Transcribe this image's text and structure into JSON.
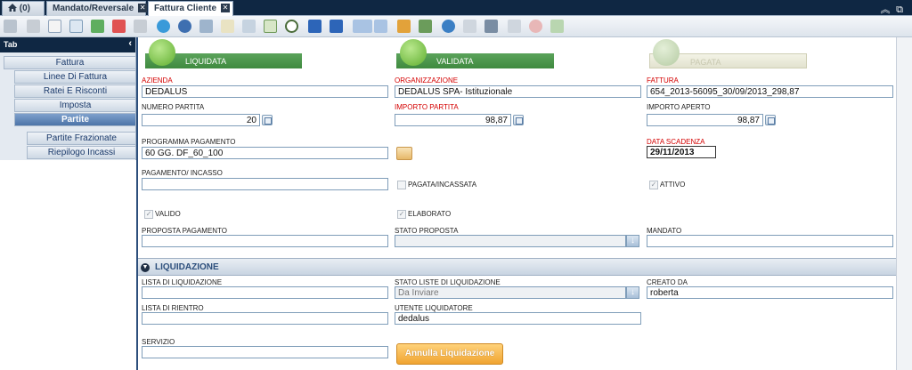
{
  "tabs": [
    {
      "label": "(0)"
    },
    {
      "label": "Mandato/Reversale"
    },
    {
      "label": "Fattura Cliente"
    }
  ],
  "sidebar": {
    "header": "Tab",
    "items": [
      {
        "label": "Fattura"
      },
      {
        "label": "Linee Di Fattura"
      },
      {
        "label": "Ratei E Risconti"
      },
      {
        "label": "Imposta"
      },
      {
        "label": "Partite"
      },
      {
        "label": "Partite Frazionate"
      },
      {
        "label": "Riepilogo Incassi"
      }
    ]
  },
  "status": {
    "liquidata": "LIQUIDATA",
    "validata": "VALIDATA",
    "pagata": "PAGATA"
  },
  "form": {
    "azienda": {
      "label": "AZIENDA",
      "value": "DEDALUS"
    },
    "organizzazione": {
      "label": "ORGANIZZAZIONE",
      "value": "DEDALUS SPA- Istituzionale"
    },
    "fattura": {
      "label": "FATTURA",
      "value": "654_2013-56095_30/09/2013_298,87"
    },
    "numero_partita": {
      "label": "NUMERO PARTITA",
      "value": "20"
    },
    "importo_partita": {
      "label": "IMPORTO PARTITA",
      "value": "98,87"
    },
    "importo_aperto": {
      "label": "IMPORTO APERTO",
      "value": "98,87"
    },
    "programma_pagamento": {
      "label": "PROGRAMMA PAGAMENTO",
      "value": "60 GG. DF_60_100"
    },
    "data_scadenza": {
      "label": "DATA SCADENZA",
      "value": "29/11/2013"
    },
    "pagamento_incasso": {
      "label": "PAGAMENTO/ INCASSO",
      "value": ""
    },
    "pagata_incassata": {
      "label": "PAGATA/INCASSATA"
    },
    "attivo": {
      "label": "ATTIVO"
    },
    "valido": {
      "label": "VALIDO"
    },
    "elaborato": {
      "label": "ELABORATO"
    },
    "proposta_pagamento": {
      "label": "PROPOSTA PAGAMENTO",
      "value": ""
    },
    "stato_proposta": {
      "label": "STATO PROPOSTA",
      "value": ""
    },
    "mandato": {
      "label": "MANDATO",
      "value": ""
    }
  },
  "liquidazione": {
    "title": "LIQUIDAZIONE",
    "lista": {
      "label": "LISTA DI LIQUIDAZIONE",
      "value": ""
    },
    "stato_liste": {
      "label": "STATO LISTE DI LIQUIDAZIONE",
      "value": "Da Inviare"
    },
    "creato_da": {
      "label": "CREATO DA",
      "value": "roberta"
    },
    "lista_rientro": {
      "label": "LISTA DI RIENTRO",
      "value": ""
    },
    "utente": {
      "label": "UTENTE LIQUIDATORE",
      "value": "dedalus"
    },
    "servizio": {
      "label": "SERVIZIO",
      "value": ""
    },
    "annulla_button": "Annulla Liquidazione"
  },
  "icons": [
    "home-icon",
    "close-icon",
    "undo-icon",
    "copy-icon",
    "new-document-icon",
    "duplicate-icon",
    "print-preview-icon",
    "delete-icon",
    "save-icon",
    "refresh-icon",
    "search-icon",
    "attach-icon",
    "note-icon",
    "link-icon",
    "table-icon",
    "clock-icon",
    "first-icon",
    "up-icon",
    "down-icon",
    "last-icon",
    "chart-icon",
    "print-icon",
    "settings-icon",
    "mail-icon",
    "scanner-icon",
    "help-icon",
    "approve-icon",
    "collapse-icon",
    "restore-icon"
  ]
}
